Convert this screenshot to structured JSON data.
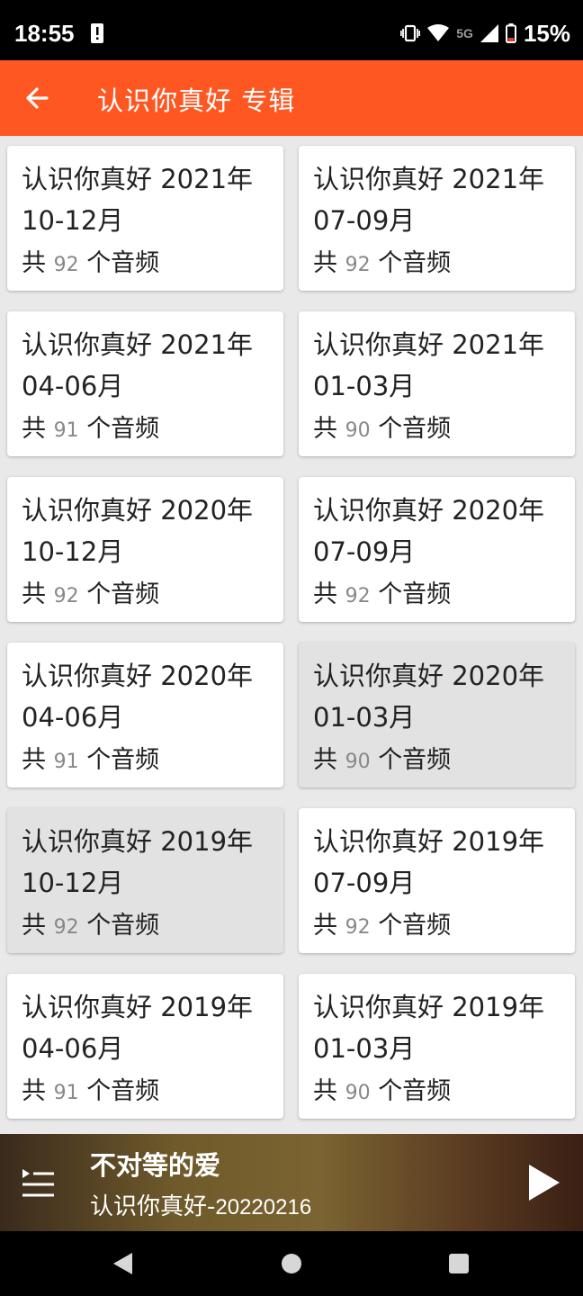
{
  "status_bar": {
    "time": "18:55",
    "network": "5G",
    "battery": "15%"
  },
  "app_bar": {
    "title": "认识你真好 专辑"
  },
  "albums": [
    {
      "title": "认识你真好 2021年 10-12月",
      "count_prefix": "共",
      "count": "92",
      "count_suffix": "个音频",
      "pressed": false
    },
    {
      "title": "认识你真好 2021年 07-09月",
      "count_prefix": "共",
      "count": "92",
      "count_suffix": "个音频",
      "pressed": false
    },
    {
      "title": "认识你真好 2021年 04-06月",
      "count_prefix": "共",
      "count": "91",
      "count_suffix": "个音频",
      "pressed": false
    },
    {
      "title": "认识你真好 2021年 01-03月",
      "count_prefix": "共",
      "count": "90",
      "count_suffix": "个音频",
      "pressed": false
    },
    {
      "title": "认识你真好 2020年 10-12月",
      "count_prefix": "共",
      "count": "92",
      "count_suffix": "个音频",
      "pressed": false
    },
    {
      "title": "认识你真好 2020年 07-09月",
      "count_prefix": "共",
      "count": "92",
      "count_suffix": "个音频",
      "pressed": false
    },
    {
      "title": "认识你真好 2020年 04-06月",
      "count_prefix": "共",
      "count": "91",
      "count_suffix": "个音频",
      "pressed": false
    },
    {
      "title": "认识你真好 2020年 01-03月",
      "count_prefix": "共",
      "count": "90",
      "count_suffix": "个音频",
      "pressed": true
    },
    {
      "title": "认识你真好 2019年 10-12月",
      "count_prefix": "共",
      "count": "92",
      "count_suffix": "个音频",
      "pressed": true
    },
    {
      "title": "认识你真好 2019年 07-09月",
      "count_prefix": "共",
      "count": "92",
      "count_suffix": "个音频",
      "pressed": false
    },
    {
      "title": "认识你真好 2019年 04-06月",
      "count_prefix": "共",
      "count": "91",
      "count_suffix": "个音频",
      "pressed": false
    },
    {
      "title": "认识你真好 2019年 01-03月",
      "count_prefix": "共",
      "count": "90",
      "count_suffix": "个音频",
      "pressed": false
    }
  ],
  "player": {
    "title": "不对等的爱",
    "subtitle_name": "认识你真好-",
    "subtitle_date": "20220216"
  },
  "colors": {
    "accent": "#ff5722"
  }
}
